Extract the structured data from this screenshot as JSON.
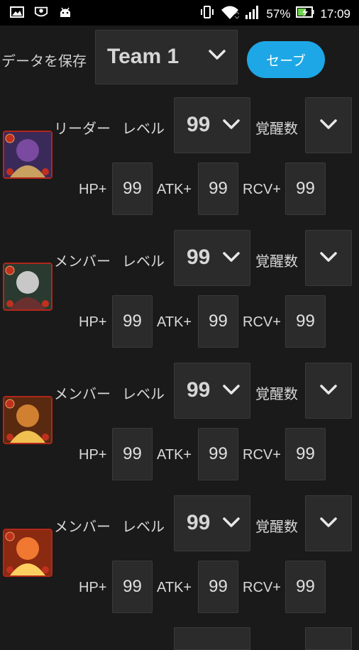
{
  "status_bar": {
    "battery": "57%",
    "time": "17:09",
    "icons": [
      "gallery-icon",
      "eye-icon",
      "android-icon",
      "vibrate-icon",
      "wifi-icon",
      "signal-icon",
      "battery-charging-icon"
    ]
  },
  "save_section": {
    "label": "データを保存",
    "team_value": "Team 1",
    "save_button": "セーブ"
  },
  "labels": {
    "level": "レベル",
    "awakening": "覚醒数",
    "hp": "HP+",
    "atk": "ATK+",
    "rcv": "RCV+"
  },
  "members": [
    {
      "role": "リーダー",
      "level": "99",
      "hp": "99",
      "atk": "99",
      "rcv": "99",
      "colors": [
        "#3a2a5a",
        "#7a4aa0",
        "#c8a060"
      ]
    },
    {
      "role": "メンバー",
      "level": "99",
      "hp": "99",
      "atk": "99",
      "rcv": "99",
      "colors": [
        "#2a3a30",
        "#c8c8c8",
        "#6a3030"
      ]
    },
    {
      "role": "メンバー",
      "level": "99",
      "hp": "99",
      "atk": "99",
      "rcv": "99",
      "colors": [
        "#5a2a10",
        "#d08030",
        "#f0c050"
      ]
    },
    {
      "role": "メンバー",
      "level": "99",
      "hp": "99",
      "atk": "99",
      "rcv": "99",
      "colors": [
        "#8a2a10",
        "#f07830",
        "#ffd060"
      ]
    }
  ]
}
